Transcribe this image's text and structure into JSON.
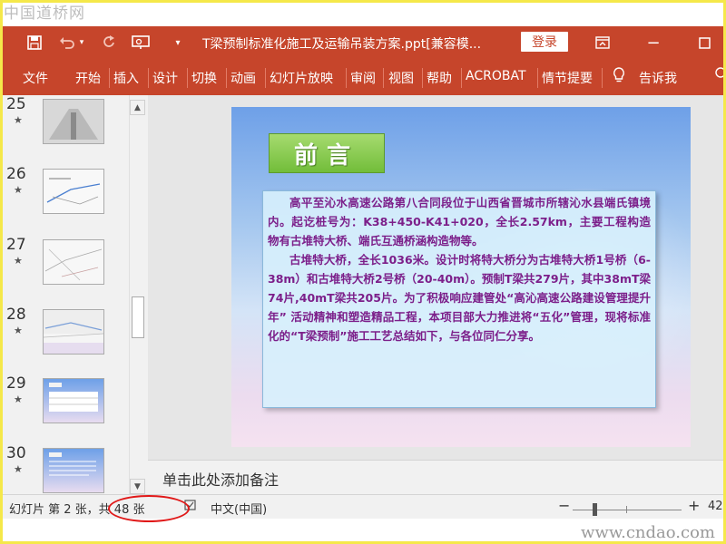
{
  "watermarks": {
    "top": "中国道桥网",
    "bottom": "www.cndao.com"
  },
  "titlebar": {
    "document_title": "T梁预制标准化施工及运输吊装方案.ppt[兼容模...",
    "login_label": "登录",
    "icons": [
      "save-icon",
      "undo-icon",
      "redo-icon",
      "present-icon",
      "customize-icon",
      "restore-icon",
      "maximize-icon"
    ]
  },
  "ribbon": {
    "tabs": [
      "文件",
      "开始",
      "插入",
      "设计",
      "切换",
      "动画",
      "幻灯片放映",
      "审阅",
      "视图",
      "帮助",
      "ACROBAT",
      "情节提要",
      "告诉我"
    ]
  },
  "thumbnails": {
    "items": [
      {
        "number": "25",
        "star": "★"
      },
      {
        "number": "26",
        "star": "★"
      },
      {
        "number": "27",
        "star": "★"
      },
      {
        "number": "28",
        "star": "★"
      },
      {
        "number": "29",
        "star": "★"
      },
      {
        "number": "30",
        "star": "★"
      }
    ]
  },
  "slide": {
    "heading": "前言",
    "paragraphs": [
      "高平至沁水高速公路第八合同段位于山西省晋城市所辖沁水县端氏镇境内。起讫桩号为：K38+450-K41+020，全长2.57km，主要工程构造物有古堆特大桥、端氏互通桥涵构造物等。",
      "古堆特大桥，全长1036米。设计时将特大桥分为古堆特大桥1号桥（6-38m）和古堆特大桥2号桥（20-40m）。预制T梁共279片，其中38mT梁74片,40mT梁共205片。为了积极响应建管处“高沁高速公路建设管理提升年” 活动精神和塑造精品工程，本项目部大力推进将“五化”管理，现将标准化的“T梁预制”施工工艺总结如下，与各位同仁分享。"
    ]
  },
  "notes": {
    "placeholder": "单击此处添加备注"
  },
  "statusbar": {
    "slide_info": "幻灯片 第 2 张，共 48 张",
    "language": "中文(中国)",
    "zoom_minus": "−",
    "zoom_plus": "+",
    "zoom_value": "42"
  },
  "colors": {
    "accent": "#c6452b",
    "heading_green": "#72bd3a",
    "body_text": "#7c1f8a"
  }
}
